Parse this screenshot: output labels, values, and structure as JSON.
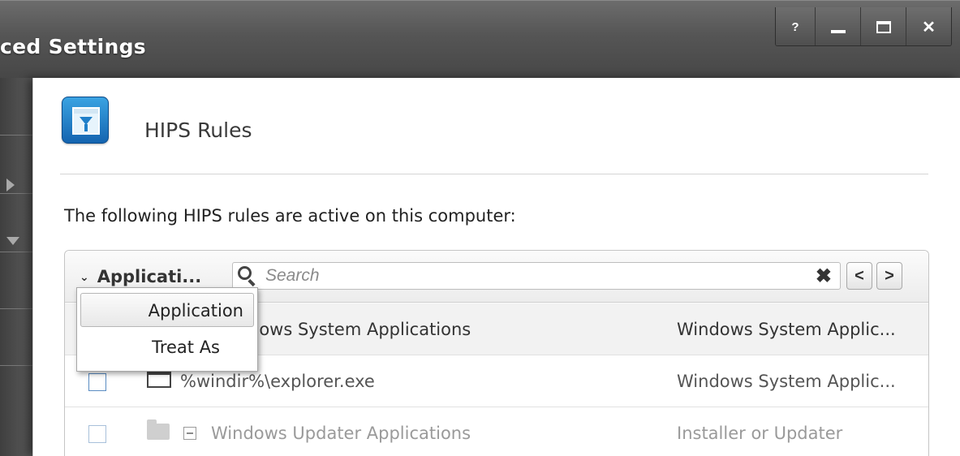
{
  "window": {
    "title": "ced Settings",
    "buttons": {
      "help": "?"
    }
  },
  "section": {
    "title": "HIPS Rules",
    "description": "The following HIPS rules are active on this computer:"
  },
  "toolbar": {
    "column_selector": "Applicati...",
    "search_placeholder": "Search"
  },
  "dropdown": {
    "items": [
      "Application",
      "Treat As"
    ]
  },
  "rules": [
    {
      "name": "dows System Applications",
      "group": "Windows System Applic..."
    },
    {
      "name": "%windir%\\explorer.exe",
      "group": "Windows System Applic..."
    },
    {
      "name": "Windows Updater Applications",
      "group": "Installer or Updater"
    }
  ]
}
